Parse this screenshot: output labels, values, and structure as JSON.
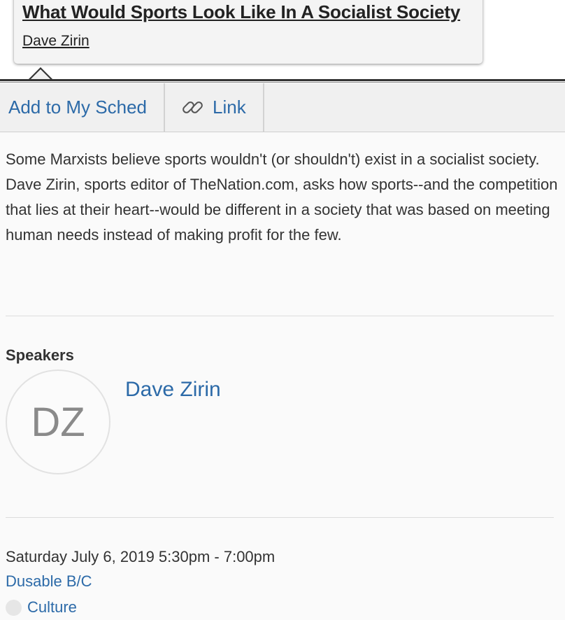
{
  "event": {
    "title": "What Would Sports Look Like In A Socialist Society",
    "speaker_link": "Dave Zirin"
  },
  "toolbar": {
    "add_label": "Add to My Sched",
    "link_label": "Link",
    "link_icon": "link-icon"
  },
  "description": "Some Marxists believe sports wouldn't (or shouldn't) exist in a socialist society. Dave Zirin, sports editor of TheNation.com, asks how sports--and the competition that lies at their heart--would be different in a society that was based on meeting human needs instead of making profit for the few.",
  "speakers": {
    "heading": "Speakers",
    "items": [
      {
        "initials": "DZ",
        "name": "Dave Zirin"
      }
    ]
  },
  "schedule": {
    "datetime": "Saturday July 6, 2019 5:30pm - 7:00pm",
    "venue": "Dusable B/C",
    "category": "Culture"
  },
  "colors": {
    "link": "#2c6aa8",
    "text": "#333333",
    "toolbar_bg": "#f0f0f0",
    "page_bg": "#fafafa"
  }
}
